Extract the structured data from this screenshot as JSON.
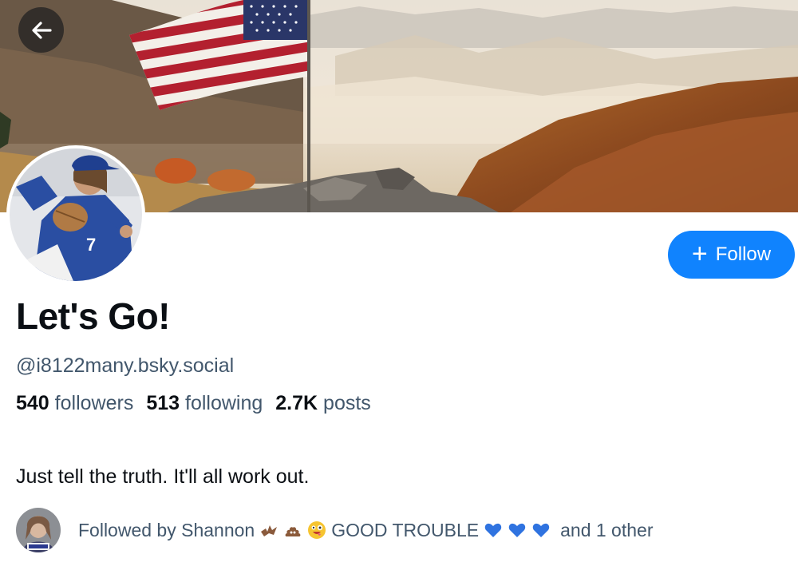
{
  "header": {
    "back_icon": "arrow-left-icon",
    "banner_alt": "banner-image"
  },
  "profile": {
    "display_name": "Let's Go!",
    "handle": "@i8122many.bsky.social",
    "followers_count": "540",
    "followers_label": "followers",
    "following_count": "513",
    "following_label": "following",
    "posts_count": "2.7K",
    "posts_label": "posts",
    "bio": "Just tell the truth. It'll all work out."
  },
  "actions": {
    "follow_label": "Follow",
    "follow_icon": "plus-icon"
  },
  "known_followers": {
    "prefix": "Followed by Shannon",
    "name_suffix": "GOOD TROUBLE",
    "suffix": "and 1 other"
  },
  "colors": {
    "accent": "#1083fe",
    "muted_text": "#42576c",
    "heart": "#2f73e0"
  }
}
